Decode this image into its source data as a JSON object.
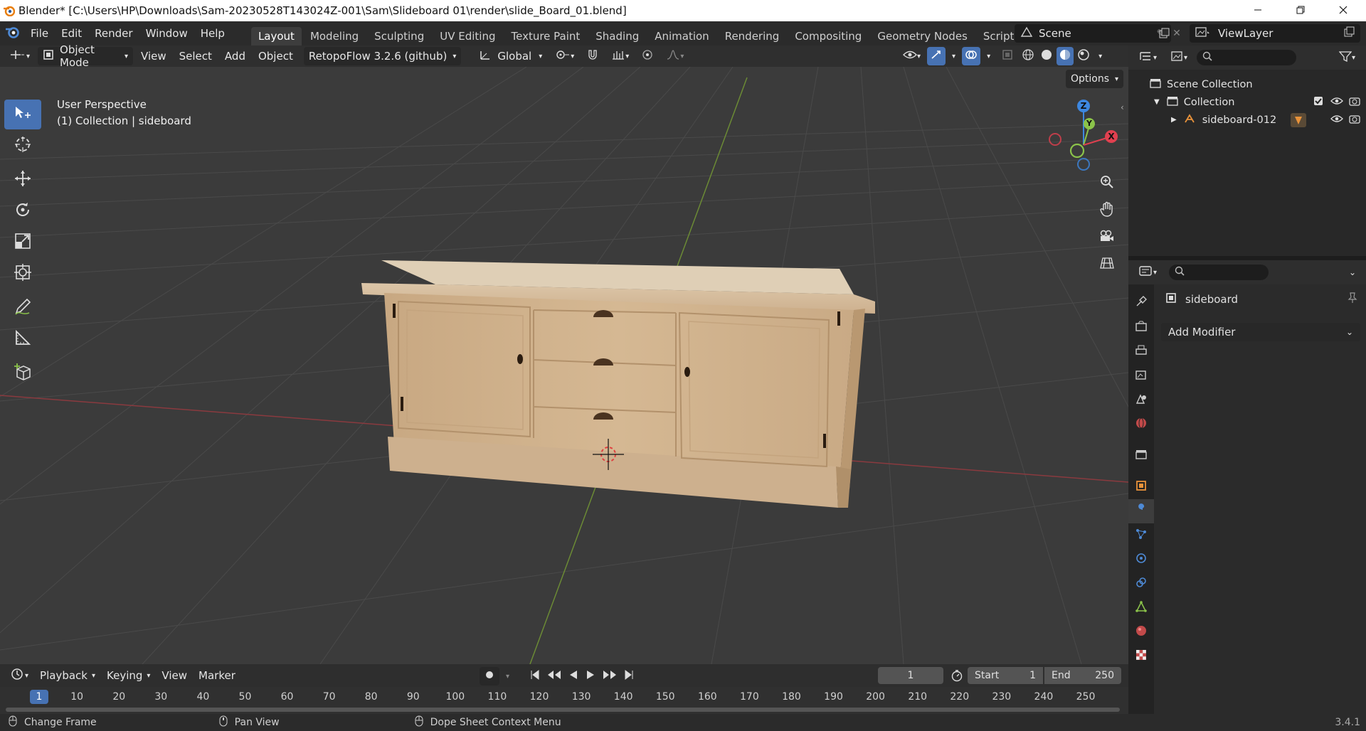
{
  "window": {
    "title": "Blender* [C:\\Users\\HP\\Downloads\\Sam-20230528T143024Z-001\\Sam\\Slideboard 01\\render\\slide_Board_01.blend]"
  },
  "menu": [
    "File",
    "Edit",
    "Render",
    "Window",
    "Help"
  ],
  "workspaces": [
    "Layout",
    "Modeling",
    "Sculpting",
    "UV Editing",
    "Texture Paint",
    "Shading",
    "Animation",
    "Rendering",
    "Compositing",
    "Geometry Nodes",
    "Scripting"
  ],
  "active_workspace": "Layout",
  "scene": {
    "name": "Scene",
    "view_layer": "ViewLayer"
  },
  "viewport_header": {
    "mode": "Object Mode",
    "menus": [
      "View",
      "Select",
      "Add",
      "Object"
    ],
    "addon": "RetopoFlow 3.2.6 (github)",
    "orientation": "Global",
    "options_label": "Options"
  },
  "viewport": {
    "perspective_label": "User Perspective",
    "collection_label": "(1) Collection | sideboard",
    "axes": {
      "z": "Z",
      "y": "Y",
      "x": "X"
    }
  },
  "outliner": {
    "scene_collection": "Scene Collection",
    "collection": "Collection",
    "object": "sideboard-012"
  },
  "properties": {
    "object_name": "sideboard",
    "add_modifier": "Add Modifier"
  },
  "timeline": {
    "menus": [
      "Playback",
      "Keying",
      "View",
      "Marker"
    ],
    "current_frame": "1",
    "start_label": "Start",
    "start_value": "1",
    "end_label": "End",
    "end_value": "250",
    "ticks": [
      "1",
      "10",
      "20",
      "30",
      "40",
      "50",
      "60",
      "70",
      "80",
      "90",
      "100",
      "110",
      "120",
      "130",
      "140",
      "150",
      "160",
      "170",
      "180",
      "190",
      "200",
      "210",
      "220",
      "230",
      "240",
      "250"
    ]
  },
  "statusbar": {
    "left": "Change Frame",
    "middle": "Pan View",
    "right": "Dope Sheet Context Menu",
    "version": "3.4.1"
  },
  "colors": {
    "accent": "#4772b3",
    "x_axis": "#e0404f",
    "y_axis": "#8bc34a",
    "z_axis": "#3d87e0"
  }
}
